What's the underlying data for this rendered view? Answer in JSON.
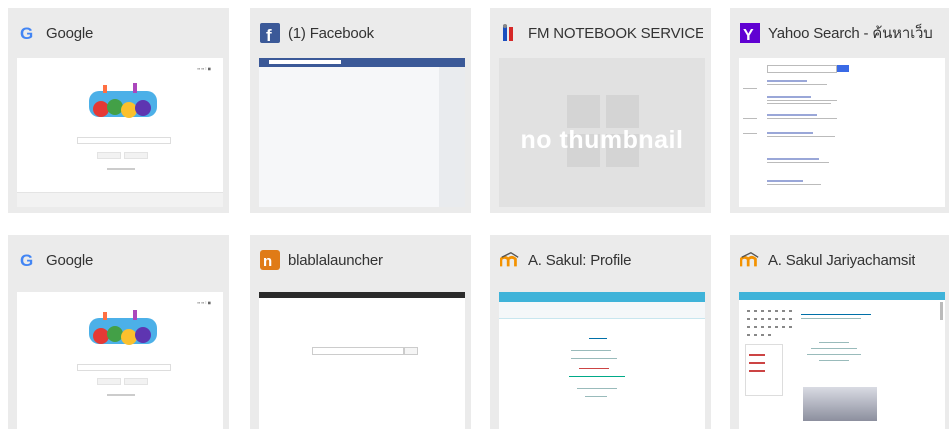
{
  "tiles": [
    {
      "title": "Google",
      "icon": "google-icon"
    },
    {
      "title": "(1) Facebook",
      "icon": "facebook-icon"
    },
    {
      "title": "FM NOTEBOOK SERVICE",
      "icon": "fm-notebook-icon"
    },
    {
      "title": "Yahoo Search - ค้นหาเว็บ",
      "icon": "yahoo-icon"
    },
    {
      "title": "Google",
      "icon": "google-icon"
    },
    {
      "title": "blablalauncher",
      "icon": "blablalauncher-icon"
    },
    {
      "title": "A. Sakul: Profile",
      "icon": "moodle-icon"
    },
    {
      "title": "A. Sakul Jariyachamsit",
      "icon": "moodle-icon"
    }
  ],
  "no_thumbnail_text": "no thumbnail",
  "colors": {
    "tile_bg": "#ebebeb",
    "facebook": "#3b5998",
    "yahoo": "#6001d2",
    "moodle": "#3fb3d9",
    "blabla": "#e07b16"
  }
}
